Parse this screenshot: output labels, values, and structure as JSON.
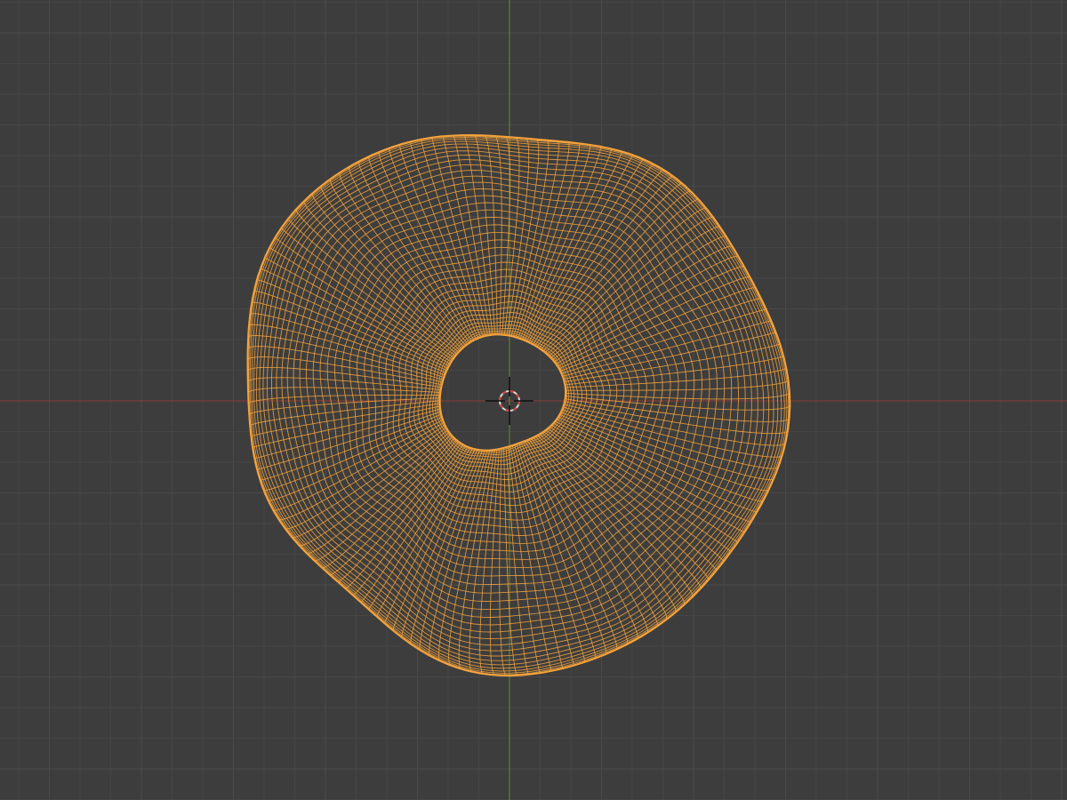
{
  "viewport": {
    "background_color": "#3d3d3d",
    "grid_minor_color": "#454545",
    "grid_major_color": "#4a4a4a",
    "x_axis_color": "#8a3b3b",
    "y_axis_color": "#6b8a2a"
  },
  "object": {
    "shape": "torus",
    "display": "wireframe",
    "selected": true,
    "wire_color": "#f5a33c"
  },
  "cursor": {
    "icon": "3d-cursor-icon",
    "ring_color_a": "#d9d9d9",
    "ring_color_b": "#d94040",
    "crosshair_color": "#111111"
  }
}
